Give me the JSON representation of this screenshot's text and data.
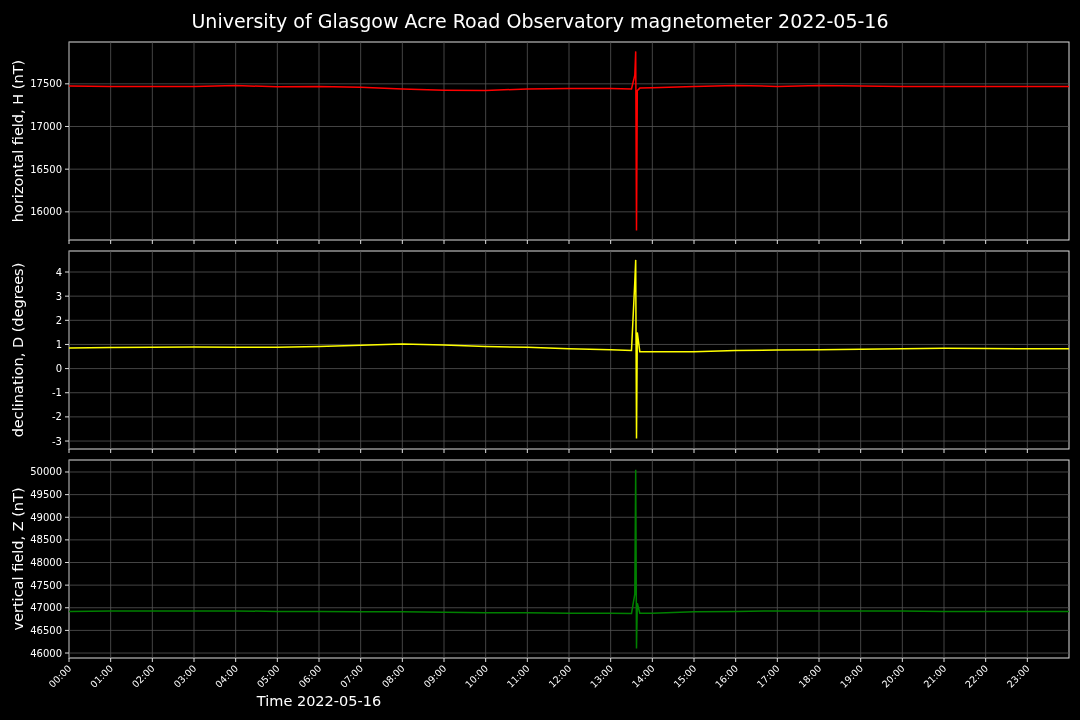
{
  "figure": {
    "title": "University of Glasgow Acre Road Observatory magnetometer 2022-05-16"
  },
  "panels": [
    {
      "chart_data": {
        "type": "line",
        "ylabel": "horizontal field, H (nT)",
        "xlim": [
          0,
          24
        ],
        "ylim": [
          15670,
          17990
        ],
        "grid": true,
        "yticks": [
          16000,
          16500,
          17000,
          17500
        ],
        "x": [
          0,
          1,
          2,
          3,
          4,
          5,
          6,
          7,
          8,
          9,
          10,
          11,
          12,
          13,
          13.5,
          13.58,
          13.6,
          13.62,
          13.64,
          13.7,
          14,
          15,
          16,
          17,
          18,
          19,
          20,
          21,
          22,
          23,
          24
        ],
        "series": [
          {
            "color": "#ff0000",
            "values": [
              17475,
              17470,
              17470,
              17470,
              17480,
              17465,
              17470,
              17460,
              17440,
              17425,
              17420,
              17440,
              17445,
              17445,
              17440,
              17600,
              17880,
              15780,
              17420,
              17450,
              17455,
              17470,
              17480,
              17470,
              17480,
              17475,
              17470,
              17470,
              17470,
              17470,
              17470
            ]
          }
        ]
      }
    },
    {
      "chart_data": {
        "type": "line",
        "ylabel": "declination, D (degrees)",
        "xlim": [
          0,
          24
        ],
        "ylim": [
          -3.33,
          4.87
        ],
        "grid": true,
        "yticks": [
          -3,
          -2,
          -1,
          0,
          1,
          2,
          3,
          4
        ],
        "x": [
          0,
          1,
          2,
          3,
          4,
          5,
          6,
          7,
          8,
          9,
          10,
          11,
          12,
          13,
          13.5,
          13.58,
          13.6,
          13.62,
          13.64,
          13.7,
          14,
          15,
          16,
          17,
          18,
          19,
          20,
          21,
          22,
          23,
          24
        ],
        "series": [
          {
            "color": "#ffff00",
            "values": [
              0.85,
              0.87,
              0.88,
              0.9,
              0.88,
              0.88,
              0.92,
              0.97,
              1.02,
              0.98,
              0.92,
              0.88,
              0.82,
              0.78,
              0.75,
              3.6,
              4.5,
              -2.9,
              1.5,
              0.7,
              0.7,
              0.7,
              0.75,
              0.77,
              0.78,
              0.8,
              0.82,
              0.84,
              0.83,
              0.82,
              0.82
            ]
          }
        ]
      }
    },
    {
      "chart_data": {
        "type": "line",
        "ylabel": "vertical field, Z (nT)",
        "xlabel": "Time 2022-05-16",
        "xlim": [
          0,
          24
        ],
        "ylim": [
          45890,
          50265
        ],
        "grid": true,
        "xticks": [
          {
            "value": 0,
            "label": "00:00"
          },
          {
            "value": 1,
            "label": "01:00"
          },
          {
            "value": 2,
            "label": "02:00"
          },
          {
            "value": 3,
            "label": "03:00"
          },
          {
            "value": 4,
            "label": "04:00"
          },
          {
            "value": 5,
            "label": "05:00"
          },
          {
            "value": 6,
            "label": "06:00"
          },
          {
            "value": 7,
            "label": "07:00"
          },
          {
            "value": 8,
            "label": "08:00"
          },
          {
            "value": 9,
            "label": "09:00"
          },
          {
            "value": 10,
            "label": "10:00"
          },
          {
            "value": 11,
            "label": "11:00"
          },
          {
            "value": 12,
            "label": "12:00"
          },
          {
            "value": 13,
            "label": "13:00"
          },
          {
            "value": 14,
            "label": "14:00"
          },
          {
            "value": 15,
            "label": "15:00"
          },
          {
            "value": 16,
            "label": "16:00"
          },
          {
            "value": 17,
            "label": "17:00"
          },
          {
            "value": 18,
            "label": "18:00"
          },
          {
            "value": 19,
            "label": "19:00"
          },
          {
            "value": 20,
            "label": "20:00"
          },
          {
            "value": 21,
            "label": "21:00"
          },
          {
            "value": 22,
            "label": "22:00"
          },
          {
            "value": 23,
            "label": "23:00"
          }
        ],
        "yticks": [
          46000,
          46500,
          47000,
          47500,
          48000,
          48500,
          49000,
          49500,
          50000
        ],
        "x": [
          0,
          1,
          2,
          3,
          4,
          5,
          6,
          7,
          8,
          9,
          10,
          11,
          12,
          13,
          13.5,
          13.58,
          13.6,
          13.62,
          13.64,
          13.7,
          14,
          15,
          16,
          17,
          18,
          19,
          20,
          21,
          22,
          23,
          24
        ],
        "series": [
          {
            "color": "#008000",
            "values": [
              46920,
              46930,
              46930,
              46930,
              46930,
              46920,
              46920,
              46910,
              46910,
              46900,
              46890,
              46890,
              46880,
              46880,
              46870,
              47300,
              50050,
              46100,
              47100,
              46880,
              46880,
              46910,
              46920,
              46930,
              46930,
              46930,
              46930,
              46920,
              46920,
              46920,
              46920
            ]
          }
        ]
      }
    }
  ]
}
